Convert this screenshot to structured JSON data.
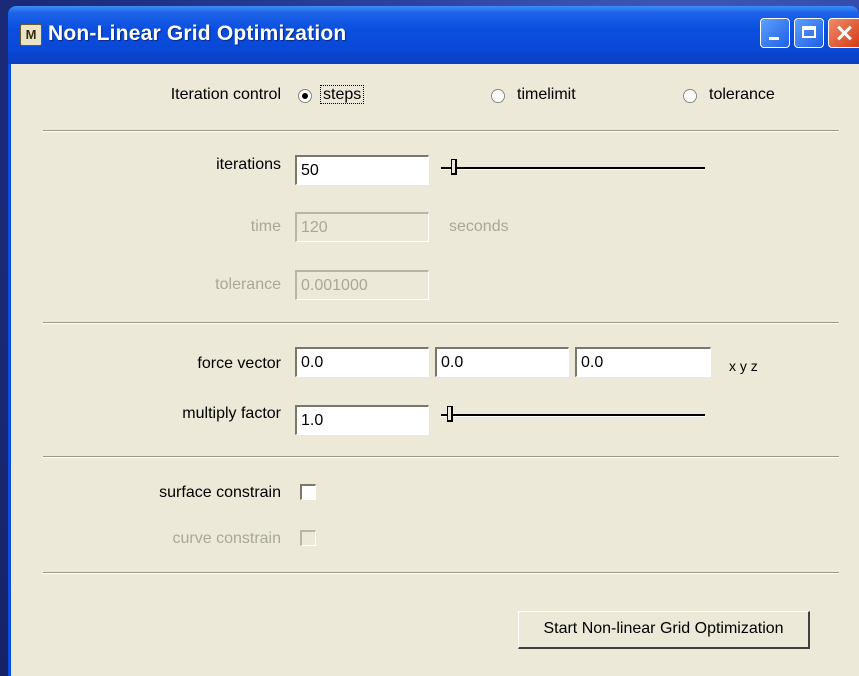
{
  "window": {
    "title": "Non-Linear Grid Optimization",
    "app_icon": "M"
  },
  "iteration_control": {
    "label": "Iteration control",
    "options": [
      {
        "label": "steps",
        "selected": true
      },
      {
        "label": "timelimit",
        "selected": false
      },
      {
        "label": "tolerance",
        "selected": false
      }
    ]
  },
  "iterations": {
    "label": "iterations",
    "value": "50",
    "slider_fraction": 0.0
  },
  "time": {
    "label": "time",
    "value": "120",
    "unit": "seconds",
    "enabled": false
  },
  "tolerance": {
    "label": "tolerance",
    "value": "0.001000",
    "enabled": false
  },
  "force_vector": {
    "label": "force vector",
    "x": "0.0",
    "y": "0.0",
    "z": "0.0",
    "suffix": "x y z"
  },
  "multiply_factor": {
    "label": "multiply factor",
    "value": "1.0",
    "slider_fraction": 0.0
  },
  "surface_constrain": {
    "label": "surface constrain",
    "checked": false,
    "enabled": true
  },
  "curve_constrain": {
    "label": "curve constrain",
    "checked": false,
    "enabled": false
  },
  "start_button": {
    "label": "Start Non-linear Grid Optimization"
  }
}
